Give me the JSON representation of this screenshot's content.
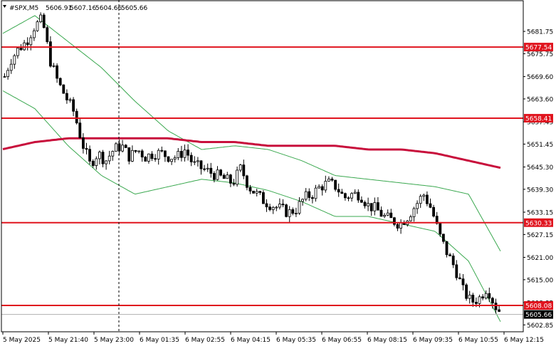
{
  "header": {
    "symbol": "#SPX,M5",
    "open": "5606.91",
    "high": "5607.16",
    "low": "5604.66",
    "close": "5605.66"
  },
  "colors": {
    "background": "#ffffff",
    "frame": "#000000",
    "candle": "#000000",
    "bollinger": "#3aa84f",
    "moving_average": "#c8103c",
    "level_line": "#e0141e",
    "level_label_bg": "#e0141e",
    "price_label_bg": "#000000"
  },
  "chart_data": {
    "type": "candlestick",
    "symbol": "#SPX",
    "timeframe": "M5",
    "ylim": [
      5601.0,
      5690.0
    ],
    "y_ticks": [
      "5681.75",
      "5675.75",
      "5669.60",
      "5663.60",
      "5657.45",
      "5651.45",
      "5645.30",
      "5639.30",
      "5633.15",
      "5627.15",
      "5621.00",
      "5615.00",
      "5608.85",
      "5602.85"
    ],
    "x_ticks": [
      "5 May 2025",
      "5 May 21:40",
      "5 May 23:00",
      "6 May 01:35",
      "6 May 02:55",
      "6 May 04:15",
      "6 May 05:35",
      "6 May 06:55",
      "6 May 08:15",
      "6 May 09:35",
      "6 May 10:55",
      "6 May 12:15"
    ],
    "levels": [
      {
        "label": "5677.54",
        "value": 5677.54
      },
      {
        "label": "5658.41",
        "value": 5658.41
      },
      {
        "label": "5630.33",
        "value": 5630.33
      },
      {
        "label": "5608.08",
        "value": 5608.08
      }
    ],
    "current_price": {
      "label": "5605.66",
      "value": 5605.66
    },
    "vertical_marker_tick": 2,
    "close_path": [
      5668,
      5674,
      5677,
      5679,
      5683,
      5685,
      5674,
      5668,
      5664,
      5660,
      5652,
      5646,
      5649,
      5647,
      5650,
      5651,
      5648,
      5650,
      5648,
      5649,
      5649,
      5648,
      5648,
      5650,
      5646,
      5645,
      5644,
      5643,
      5642,
      5641,
      5645,
      5640,
      5638,
      5636,
      5635,
      5634,
      5633,
      5634,
      5637,
      5638,
      5640,
      5641,
      5640,
      5637,
      5638,
      5638,
      5635,
      5634,
      5632,
      5631,
      5630,
      5632,
      5635,
      5638,
      5634,
      5627,
      5622,
      5618,
      5612,
      5609,
      5610,
      5613,
      5608,
      5605.66
    ],
    "ma": [
      5650,
      5652,
      5653,
      5653,
      5653,
      5653,
      5652,
      5652,
      5651,
      5651,
      5651,
      5650,
      5650,
      5649,
      5647,
      5645
    ],
    "bb_upper": [
      5681,
      5686,
      5679,
      5672,
      5663,
      5655,
      5650,
      5651,
      5650,
      5647,
      5643,
      5642,
      5641,
      5640,
      5638,
      5622
    ],
    "bb_lower": [
      5666,
      5661,
      5651,
      5643,
      5638,
      5640,
      5642,
      5641,
      5639,
      5636,
      5632,
      5632,
      5630,
      5628,
      5620,
      5603
    ]
  }
}
